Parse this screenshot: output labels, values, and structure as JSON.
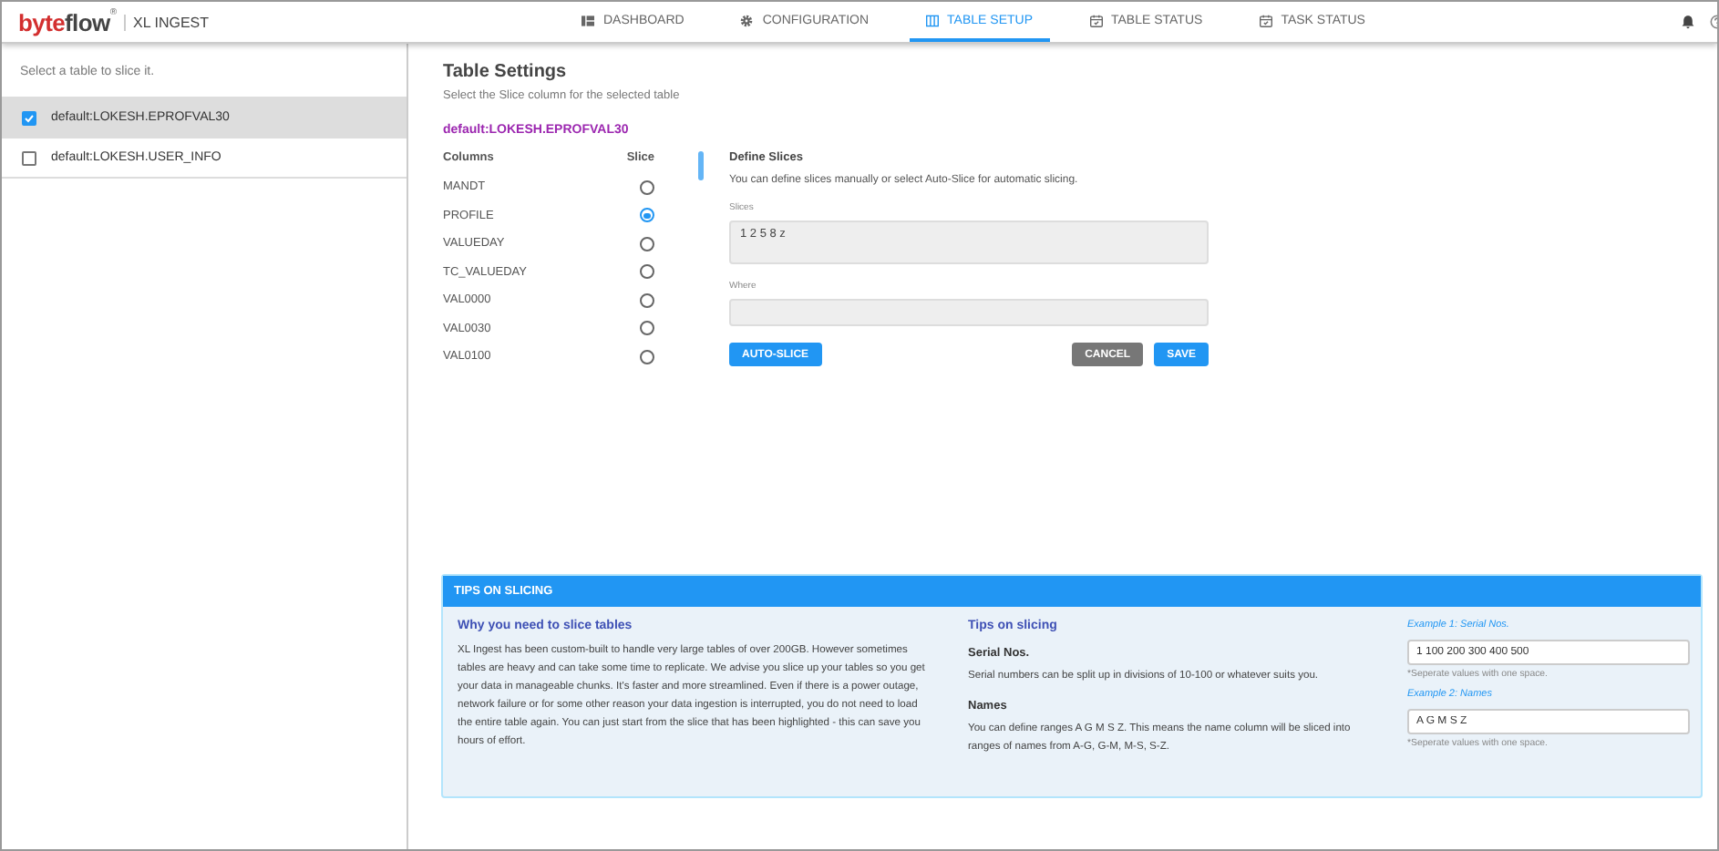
{
  "logo": {
    "word_a": "byte",
    "word_b": "flow",
    "mark": "®",
    "product": "XL INGEST"
  },
  "nav": [
    {
      "label": "DASHBOARD",
      "kind": "dashboard",
      "selected": false
    },
    {
      "label": "CONFIGURATION",
      "kind": "configuration",
      "selected": false
    },
    {
      "label": "TABLE SETUP",
      "kind": "setup",
      "selected": true
    },
    {
      "label": "TABLE STATUS",
      "kind": "status",
      "selected": false
    },
    {
      "label": "TASK STATUS",
      "kind": "status",
      "selected": false
    }
  ],
  "sidebar": {
    "hint": "Select a table to slice it.",
    "items": [
      {
        "label": "default:LOKESH.EPROFVAL30",
        "checked": true,
        "selected": true
      },
      {
        "label": "default:LOKESH.USER_INFO",
        "checked": false,
        "selected": false
      }
    ]
  },
  "settings": {
    "title": "Table Settings",
    "subtitle": "Select the Slice column for the selected table",
    "table_name": "default:LOKESH.EPROFVAL30",
    "columns_header": "Columns",
    "slice_header": "Slice",
    "columns": [
      {
        "name": "MANDT",
        "selected": false
      },
      {
        "name": "PROFILE",
        "selected": true
      },
      {
        "name": "VALUEDAY",
        "selected": false
      },
      {
        "name": "TC_VALUEDAY",
        "selected": false
      },
      {
        "name": "VAL0000",
        "selected": false
      },
      {
        "name": "VAL0030",
        "selected": false
      },
      {
        "name": "VAL0100",
        "selected": false
      }
    ]
  },
  "define": {
    "title": "Define Slices",
    "text": "You can define slices manually or select Auto-Slice for automatic slicing.",
    "slices_label": "Slices",
    "slices_value": "1 2 5 8 z",
    "where_label": "Where",
    "buttons": [
      {
        "label": "AUTO-SLICE",
        "kind": "primary"
      },
      {
        "label": "CANCEL",
        "kind": "secondary"
      },
      {
        "label": "SAVE",
        "kind": "primary"
      }
    ]
  },
  "tips": {
    "header": "TIPS ON SLICING",
    "why_title": "Why you need to slice tables",
    "why_text": "XL Ingest has been custom-built to handle very large tables of over 200GB. However sometimes tables are heavy and can take some time to replicate. We advise you slice up your tables so you get your data in manageable chunks. It's faster and more streamlined. Even if there is a power outage, network failure or for some other reason your data ingestion is interrupted, you do not need to load the entire table again. You can just start from the slice that has been highlighted - this can save you hours of effort.",
    "tips_title": "Tips on slicing",
    "items": [
      {
        "title": "Serial Nos.",
        "text": "Serial numbers can be split up in divisions of 10-100 or whatever suits you."
      },
      {
        "title": "Names",
        "text": "You can define ranges A G M S Z. This means the name column will be sliced into ranges of names from A-G, G-M, M-S, S-Z."
      }
    ],
    "examples": [
      {
        "label": "Example 1: Serial Nos.",
        "value": "1 100 200 300 400 500",
        "note": "*Seperate values with one space."
      },
      {
        "label": "Example 2: Names",
        "value": "A G M S Z",
        "note": "*Seperate values with one space."
      }
    ]
  }
}
